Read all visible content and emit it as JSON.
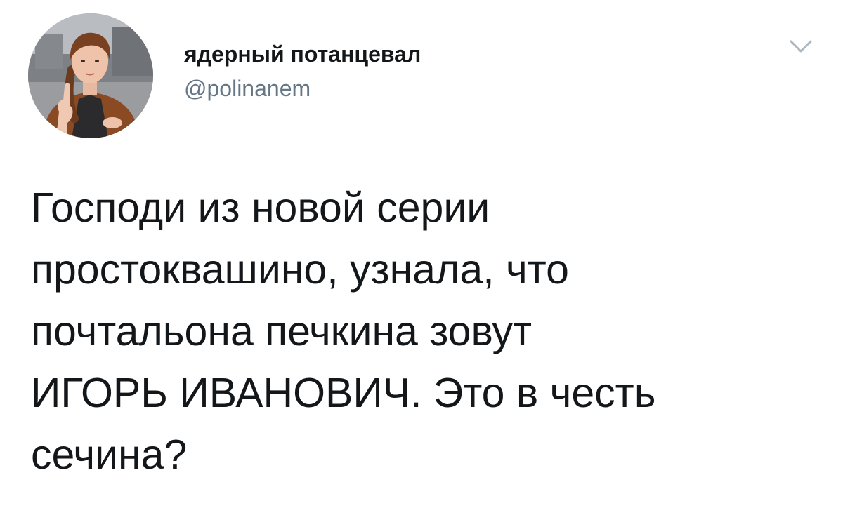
{
  "author": {
    "display_name": "ядерный потанцевал",
    "handle": "@polinanem"
  },
  "menu": {
    "icon": "chevron-down-icon"
  },
  "tweet": {
    "text": "Господи из новой серии\nпростоквашино, узнала, что\nпочтальона печкина зовут\nИГОРЬ ИВАНОВИЧ. Это в честь\nсечина?"
  },
  "colors": {
    "name": "#14171a",
    "handle": "#657786",
    "caret": "#aab8c2",
    "background": "#ffffff"
  }
}
